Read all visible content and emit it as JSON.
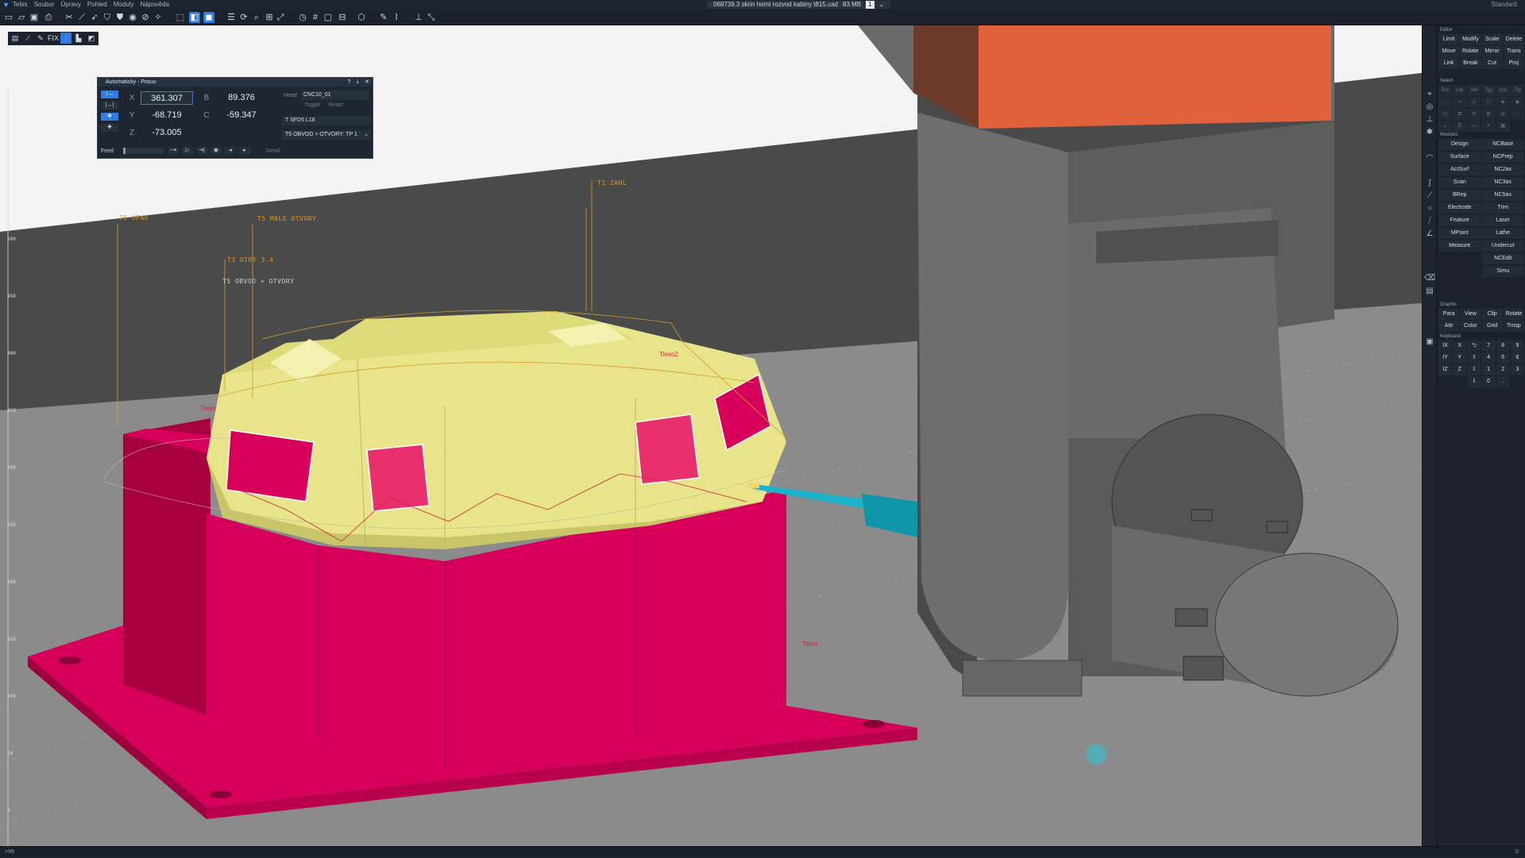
{
  "menubar": {
    "items": [
      "Tebis",
      "Soubor",
      "Úpravy",
      "Pohled",
      "Moduly",
      "Nápověda"
    ],
    "document": "068739.3 skrin horni rozvod kabiny t815.cad",
    "size": "83 MB",
    "page": "1",
    "profile": "Standard"
  },
  "toolbar2": {
    "fix_label": "FIX"
  },
  "ruler": {
    "ticks": [
      "500",
      "450",
      "400",
      "350",
      "300",
      "250",
      "200",
      "150",
      "100",
      "50",
      "0"
    ]
  },
  "operations": {
    "t1": "T1 ZAHL",
    "t5_upad": "T5 UPAD",
    "t5_male": "T5 MALE OTVORY",
    "t3": "T3 DIRY 3.4",
    "t5_obvod": "T5 OBVOD + OTVORY"
  },
  "bodies": {
    "b1": "Tleso2",
    "b2": "Tleso",
    "b3": "Tleso"
  },
  "panel": {
    "title": "Automaticky - Posuv",
    "ctrl_help": "?",
    "ctrl_pin": "⇣",
    "ctrl_close": "✕",
    "side_buttons": [
      "↕↔",
      "|↔|",
      "✥",
      "✚"
    ],
    "x_label": "X",
    "x_value": "361.307",
    "y_label": "Y",
    "y_value": "-68.719",
    "z_label": "Z",
    "z_value": "-73.005",
    "b_label": "B",
    "b_value": "89.376",
    "c_label": "C",
    "c_value": "-59.347",
    "head_label": "Head",
    "head_value": "CNC10_01",
    "toggle_label": "Toggle",
    "reset_label": "Reset",
    "tool_value": "T SFD5 L18",
    "operation_value": "T5 OBVOD + OTVORY: TP 1",
    "feed_label": "Feed",
    "play_buttons": [
      "◦⇥",
      "▷",
      "⇥|",
      "◉",
      "◂",
      "▸"
    ],
    "detail_label": "Detail"
  },
  "right_panel": {
    "editor": {
      "title": "Editor",
      "buttons": [
        "Limit",
        "Modify",
        "Scale",
        "Delete",
        "Move",
        "Rotate",
        "Mirror",
        "Trans",
        "Link",
        "Break",
        "Cut",
        "Proj"
      ]
    },
    "select": {
      "title": "Select",
      "buttons": [
        "Ent",
        "Lay",
        "Set",
        "Typ",
        "Col",
        "Trp"
      ]
    },
    "modules": {
      "title": "Modules",
      "rows": [
        [
          "Design",
          "NCBase"
        ],
        [
          "Surface",
          "NCPrep"
        ],
        [
          "ActSurf",
          "NC2ax"
        ],
        [
          "Scan",
          "NC3ax"
        ],
        [
          "BRep",
          "NC5ax"
        ],
        [
          "Electrode",
          "Trim"
        ],
        [
          "Feature",
          "Laser"
        ],
        [
          "MPoint",
          "Lathe"
        ],
        [
          "Measure",
          "Undercut"
        ],
        [
          "",
          "NCEdit"
        ],
        [
          "",
          "Simu"
        ]
      ]
    },
    "graphic": {
      "title": "Graphic",
      "buttons": [
        "Para",
        "View",
        "Clip",
        "Rotate",
        "Attr",
        "Color",
        "Grid",
        "Trnsp"
      ]
    },
    "keyboard": {
      "title": "Keyboard",
      "keys": [
        "IX",
        "X",
        "⮌",
        "7",
        "8",
        "9",
        "IY",
        "Y",
        "⇧",
        "4",
        "5",
        "6",
        "IZ",
        "Z",
        "⇩",
        "1",
        "2",
        "3",
        "",
        "",
        "⇩",
        "0",
        ".",
        ""
      ]
    }
  },
  "statusbar": {
    "left": ">99",
    "right": "0"
  },
  "colors": {
    "accent": "#2f7de0",
    "part_yellow": "#e7e48a",
    "part_magenta": "#d6005a",
    "head_orange": "#e0623c",
    "tool_cyan": "#1ab3c9"
  }
}
